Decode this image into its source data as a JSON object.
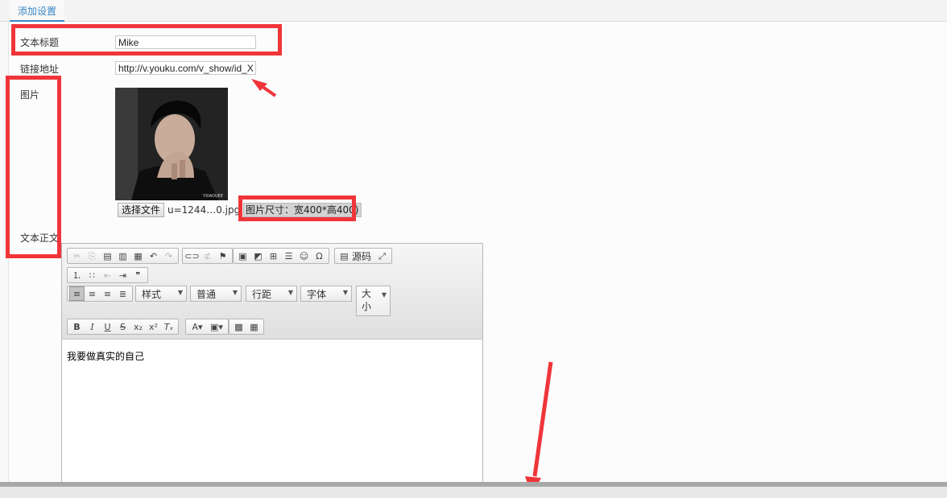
{
  "tabs": [
    {
      "label": "添加设置",
      "active": true
    }
  ],
  "form": {
    "title_label": "文本标题",
    "title_value": "Mike",
    "link_label": "链接地址",
    "link_value": "http://v.youku.com/v_show/id_XI",
    "image_label": "图片",
    "image_caption": "YXIADUEE",
    "file_button": "选择文件",
    "file_name": "u=1244…0.jpg",
    "size_hint": "图片尺寸：宽400*高400)",
    "body_label": "文本正文"
  },
  "editor": {
    "toolbar": {
      "source_label": "源码",
      "style_label": "样式",
      "format_label": "普通",
      "line_height_label": "行距",
      "font_label": "字体",
      "size_label_1": "大",
      "size_label_2": "小",
      "icons": [
        "cut-icon",
        "copy-icon",
        "paste-icon",
        "paste-text-icon",
        "paste-word-icon",
        "undo-icon",
        "redo-icon",
        "link-icon",
        "unlink-icon",
        "anchor-icon",
        "image-icon",
        "flash-icon",
        "table-icon",
        "horizontal-line-icon",
        "smiley-icon",
        "special-char-icon",
        "maximize-icon",
        "numbered-list-icon",
        "bullet-list-icon",
        "outdent-icon",
        "indent-icon",
        "blockquote-icon",
        "align-left-icon",
        "align-center-icon",
        "align-right-icon",
        "justify-icon",
        "bold-icon",
        "italic-icon",
        "underline-icon",
        "strike-icon",
        "subscript-icon",
        "superscript-icon",
        "remove-format-icon",
        "text-color-icon",
        "bg-color-icon",
        "insert-media-icon",
        "qrcode-icon"
      ]
    },
    "content": "我要做真实的自己"
  },
  "colors": {
    "annotation_red": "#f0353a",
    "tab_accent": "#3a86c8"
  }
}
